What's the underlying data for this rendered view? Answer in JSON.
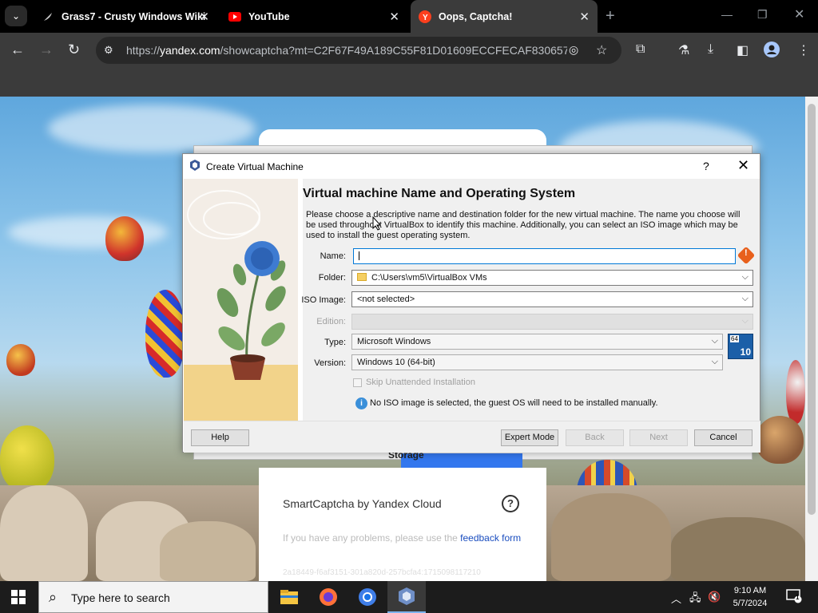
{
  "browser": {
    "tabs": [
      {
        "title": "Grass7 - Crusty Windows Wiki",
        "icon": "feather-icon"
      },
      {
        "title": "YouTube",
        "icon": "youtube-icon"
      },
      {
        "title": "Oops, Captcha!",
        "icon": "yandex-icon",
        "active": true
      }
    ],
    "url_prefix": "https://",
    "url_host": "yandex.com",
    "url_rest": "/showcaptcha?mt=C2F67F49A189C55F81D01609ECCFECAF830657E..."
  },
  "captcha": {
    "brand": "SmartCaptcha by Yandex Cloud",
    "help": "?",
    "problem_text": "If you have any problems, please use the ",
    "feedback_link": "feedback form",
    "request_id": "2a18449-f6af3151-301a820d-257bcfa4:1715098117210"
  },
  "behind": {
    "storage_label": "Storage"
  },
  "dialog": {
    "title": "Create Virtual Machine",
    "help_glyph": "?",
    "close_glyph": "✕",
    "heading": "Virtual machine Name and Operating System",
    "description": "Please choose a descriptive name and destination folder for the new virtual machine. The name you choose will be used throughout VirtualBox to identify this machine. Additionally, you can select an ISO image which may be used to install the guest operating system.",
    "fields": {
      "name_label": "Name:",
      "name_value": "",
      "folder_label": "Folder:",
      "folder_value": "C:\\Users\\vm5\\VirtualBox VMs",
      "iso_label": "ISO Image:",
      "iso_value": "<not selected>",
      "edition_label": "Edition:",
      "edition_value": "",
      "type_label": "Type:",
      "type_value": "Microsoft Windows",
      "version_label": "Version:",
      "version_value": "Windows 10 (64-bit)"
    },
    "os_badge": {
      "bits": "64",
      "version": "10"
    },
    "skip_unattended": "Skip Unattended Installation",
    "info": "No ISO image is selected, the guest OS will need to be installed manually.",
    "buttons": {
      "help": "Help",
      "expert": "Expert Mode",
      "back": "Back",
      "next": "Next",
      "cancel": "Cancel"
    }
  },
  "taskbar": {
    "search_placeholder": "Type here to search",
    "time": "9:10 AM",
    "date": "5/7/2024",
    "notification_count": "1"
  }
}
